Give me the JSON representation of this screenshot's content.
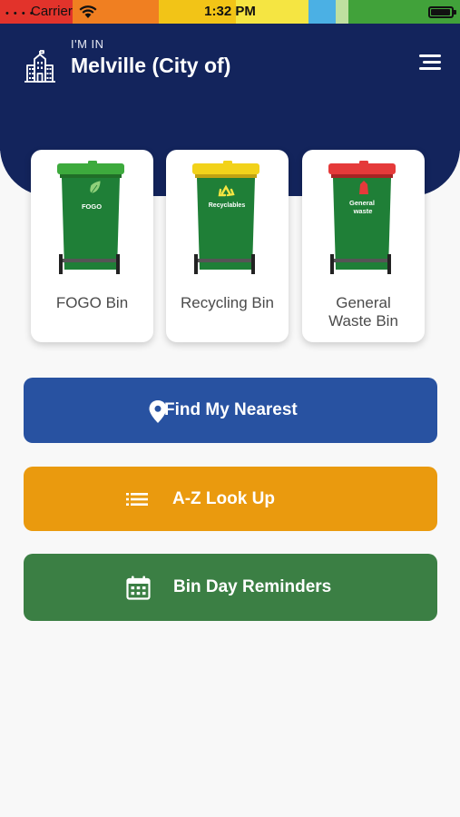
{
  "status_bar": {
    "dots": "• • • •",
    "carrier": "Carrier",
    "time": "1:32 PM",
    "wifi_icon": "wifi-icon",
    "battery_icon": "battery-icon"
  },
  "header": {
    "kicker": "I'M IN",
    "title": "Melville (City of)",
    "city_icon": "city-building-icon",
    "menu_icon": "menu-icon",
    "background_color": "#13245c"
  },
  "bins": [
    {
      "name": "FOGO Bin",
      "lid_label": "FOGO",
      "lid_color": "#3daa3d",
      "icon": "leaf-icon"
    },
    {
      "name": "Recycling Bin",
      "lid_label": "Recyclables",
      "lid_color": "#f2d21a",
      "icon": "recycle-icon"
    },
    {
      "name": "General Waste Bin",
      "lid_label": "General waste",
      "lid_color": "#e53a3a",
      "icon": "trash-bag-icon"
    }
  ],
  "actions": [
    {
      "label": "Find My Nearest",
      "icon": "map-pin-icon",
      "color": "#2852a1"
    },
    {
      "label": "A-Z Look Up",
      "icon": "list-icon",
      "color": "#ea9a0e"
    },
    {
      "label": "Bin Day Reminders",
      "icon": "calendar-icon",
      "color": "#3b7f44"
    }
  ]
}
